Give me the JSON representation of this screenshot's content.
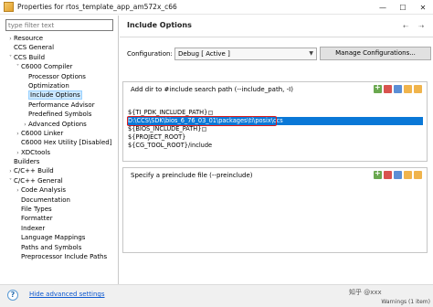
{
  "window": {
    "title": "Properties for rtos_template_app_am572x_c66",
    "minimize_icon": "minimize-icon",
    "maximize_icon": "maximize-icon",
    "close_icon": "close-icon"
  },
  "left": {
    "filter_placeholder": "type filter text",
    "tree": [
      {
        "label": "Resource",
        "depth": 0,
        "twisty": ">"
      },
      {
        "label": "CCS General",
        "depth": 0,
        "twisty": ""
      },
      {
        "label": "CCS Build",
        "depth": 0,
        "twisty": "v"
      },
      {
        "label": "C6000 Compiler",
        "depth": 1,
        "twisty": "v"
      },
      {
        "label": "Processor Options",
        "depth": 2,
        "twisty": ""
      },
      {
        "label": "Optimization",
        "depth": 2,
        "twisty": ""
      },
      {
        "label": "Include Options",
        "depth": 2,
        "twisty": "",
        "selected": true
      },
      {
        "label": "Performance Advisor",
        "depth": 2,
        "twisty": ""
      },
      {
        "label": "Predefined Symbols",
        "depth": 2,
        "twisty": ""
      },
      {
        "label": "Advanced Options",
        "depth": 2,
        "twisty": ">"
      },
      {
        "label": "C6000 Linker",
        "depth": 1,
        "twisty": ">"
      },
      {
        "label": "C6000 Hex Utility  [Disabled]",
        "depth": 1,
        "twisty": ""
      },
      {
        "label": "XDCtools",
        "depth": 1,
        "twisty": ">"
      },
      {
        "label": "Builders",
        "depth": 0,
        "twisty": ""
      },
      {
        "label": "C/C++ Build",
        "depth": 0,
        "twisty": ">"
      },
      {
        "label": "C/C++ General",
        "depth": 0,
        "twisty": "v"
      },
      {
        "label": "Code Analysis",
        "depth": 1,
        "twisty": ">"
      },
      {
        "label": "Documentation",
        "depth": 1,
        "twisty": ""
      },
      {
        "label": "File Types",
        "depth": 1,
        "twisty": ""
      },
      {
        "label": "Formatter",
        "depth": 1,
        "twisty": ""
      },
      {
        "label": "Indexer",
        "depth": 1,
        "twisty": ""
      },
      {
        "label": "Language Mappings",
        "depth": 1,
        "twisty": ""
      },
      {
        "label": "Paths and Symbols",
        "depth": 1,
        "twisty": ""
      },
      {
        "label": "Preprocessor Include Paths",
        "depth": 1,
        "twisty": ""
      }
    ]
  },
  "page": {
    "title": "Include Options",
    "back_icon": "back-arrow-icon",
    "forward_icon": "forward-arrow-icon",
    "configuration_label": "Configuration:",
    "configuration_value": "Debug  [ Active ]",
    "manage_button": "Manage Configurations...",
    "include_box_label": "Add dir to #include search path (--include_path, -I)",
    "include_paths": [
      "${TI_PDK_INCLUDE_PATH}",
      "D:\\CCS\\SDK\\bios_6_76_03_01\\packages\\ti\\posix\\ccs",
      "${BIOS_INCLUDE_PATH}",
      "${PROJECT_ROOT}",
      "${CG_TOOL_ROOT}/include"
    ],
    "preinclude_box_label": "Specify a preinclude file (--preinclude)"
  },
  "footer": {
    "help_icon": "help-icon",
    "advanced_link": "Hide advanced settings",
    "watermark": "知乎 @xxx",
    "warning_tab": "Warnings (1 item)"
  }
}
